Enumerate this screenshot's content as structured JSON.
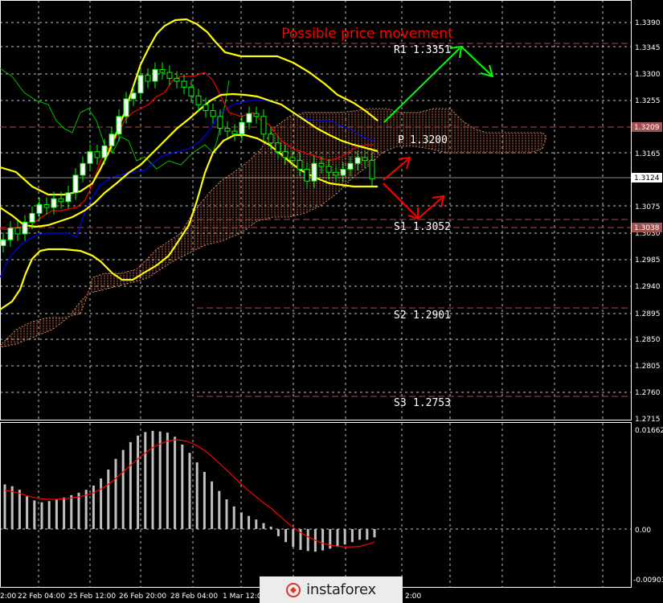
{
  "chart_data": {
    "type": "candlestick",
    "title": "Possible price movement",
    "price_axis": {
      "ticks": [
        "1.3390",
        "1.3345",
        "1.3300",
        "1.3255",
        "1.3165",
        "1.3075",
        "1.3030",
        "1.2985",
        "1.2940",
        "1.2895",
        "1.2850",
        "1.2805",
        "1.2760",
        "1.2715"
      ],
      "range": [
        1.2715,
        1.339
      ]
    },
    "time_axis": {
      "labels": [
        "22 Feb 04:00",
        "25 Feb 12:00",
        "26 Feb 20:00",
        "28 Feb 04:00",
        "1 Mar 12:00"
      ],
      "visible_fragments": [
        "2:00",
        "2:00"
      ]
    },
    "pivots": [
      {
        "name": "R1",
        "value": "1.3351"
      },
      {
        "name": "P",
        "value": "1.3200"
      },
      {
        "name": "S1",
        "value": "1.3052"
      },
      {
        "name": "S2",
        "value": "1.2901"
      },
      {
        "name": "S3",
        "value": "1.2753"
      }
    ],
    "price_tags": [
      {
        "value": "1.3209",
        "color": "#a05050"
      },
      {
        "value": "1.3124",
        "color": "#ffffff"
      },
      {
        "value": "1.3038",
        "color": "#a05050"
      }
    ],
    "indicator": {
      "type": "histogram",
      "ticks": [
        "0.01662",
        "0.00",
        "-0.00903"
      ],
      "range": [
        -0.00903,
        0.01662
      ],
      "histogram": [
        0.0075,
        0.0072,
        0.0066,
        0.0055,
        0.0048,
        0.0045,
        0.0047,
        0.005,
        0.0053,
        0.0057,
        0.0061,
        0.0066,
        0.0073,
        0.0085,
        0.01,
        0.0118,
        0.0133,
        0.0146,
        0.0157,
        0.0163,
        0.0165,
        0.0164,
        0.0162,
        0.0155,
        0.0142,
        0.0128,
        0.0112,
        0.0096,
        0.008,
        0.0064,
        0.005,
        0.0038,
        0.0028,
        0.0022,
        0.0016,
        0.001,
        0.0004,
        -0.0012,
        -0.0022,
        -0.003,
        -0.0035,
        -0.0037,
        -0.0038,
        -0.0036,
        -0.0033,
        -0.003,
        -0.0026,
        -0.0022,
        -0.0018,
        -0.0018,
        -0.0014
      ],
      "signal": [
        0.0065,
        0.0063,
        0.006,
        0.0056,
        0.0053,
        0.0051,
        0.005,
        0.005,
        0.0051,
        0.0052,
        0.0054,
        0.0057,
        0.0061,
        0.0067,
        0.0075,
        0.0085,
        0.0096,
        0.0107,
        0.0118,
        0.0128,
        0.0137,
        0.0143,
        0.0148,
        0.015,
        0.0149,
        0.0146,
        0.014,
        0.0132,
        0.0122,
        0.0111,
        0.0099,
        0.0087,
        0.0075,
        0.0064,
        0.0054,
        0.0044,
        0.0035,
        0.0024,
        0.0013,
        0.0003,
        -0.0006,
        -0.0013,
        -0.0019,
        -0.0024,
        -0.0027,
        -0.0029,
        -0.003,
        -0.003,
        -0.0029,
        -0.0026,
        -0.0022
      ]
    },
    "close_prices": [
      1.302,
      1.304,
      1.303,
      1.305,
      1.3065,
      1.308,
      1.3075,
      1.309,
      1.3085,
      1.31,
      1.313,
      1.315,
      1.317,
      1.316,
      1.318,
      1.32,
      1.323,
      1.326,
      1.327,
      1.33,
      1.329,
      1.331,
      1.3305,
      1.3295,
      1.329,
      1.328,
      1.3265,
      1.325,
      1.324,
      1.323,
      1.321,
      1.3205,
      1.32,
      1.322,
      1.3235,
      1.323,
      1.32,
      1.3185,
      1.317,
      1.316,
      1.3155,
      1.314,
      1.312,
      1.315,
      1.3145,
      1.3135,
      1.313,
      1.314,
      1.315,
      1.316,
      1.3155,
      1.3124
    ],
    "colors": {
      "background": "#000000",
      "bollinger": "#ffff00",
      "tenkan": "#ff0000",
      "kijun": "#0000ff",
      "chikou": "#00c000",
      "cloud": "#d08a6a",
      "candle": "#00ff00",
      "candle_body": "#ffffff",
      "up_arrow": "#00ff00",
      "down_arrow": "#ff0000",
      "pivot_line": "#a05050",
      "histogram": "#c0c0c0",
      "signal": "#ff0000",
      "title": "#ff0000"
    }
  },
  "brand": {
    "name": "instaforex"
  }
}
